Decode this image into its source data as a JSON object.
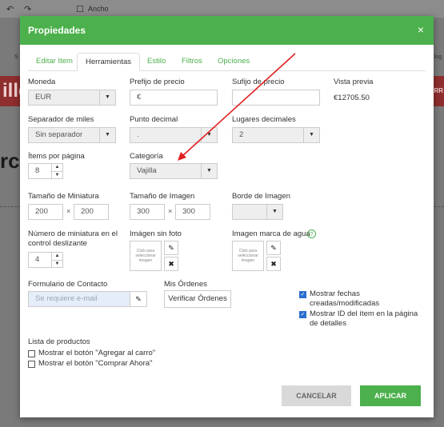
{
  "background": {
    "toolbar_label": "Ancho",
    "red_text_left": "ille",
    "red_text_right": "ARR",
    "big_text": "rc",
    "side_small_left": "S",
    "side_small_right": "log"
  },
  "modal": {
    "title": "Propiedades",
    "close_glyph": "×",
    "accent": "#4cb04c",
    "tabs": [
      {
        "label": "Editar Item"
      },
      {
        "label": "Herramientas"
      },
      {
        "label": "Estilo"
      },
      {
        "label": "Filtros"
      },
      {
        "label": "Opciones"
      }
    ],
    "fields": {
      "moneda": {
        "label": "Moneda",
        "value": "EUR"
      },
      "prefijo": {
        "label": "Prefijo de precio",
        "value": "€"
      },
      "sufijo": {
        "label": "Sufijo de precio",
        "value": ""
      },
      "vista_previa": {
        "label": "Vista previa",
        "value": "€12705.50"
      },
      "separador": {
        "label": "Separador de miles",
        "value": "Sin separador"
      },
      "punto": {
        "label": "Punto decimal",
        "value": "."
      },
      "lugares": {
        "label": "Lugares decimales",
        "value": "2"
      },
      "items_pagina": {
        "label": "Ítems por página",
        "value": "8"
      },
      "categoria": {
        "label": "Categoría",
        "value": "Vajilla"
      },
      "miniatura": {
        "label": "Tamaño de Miniatura",
        "w": "200",
        "h": "200",
        "times": "×"
      },
      "imagen": {
        "label": "Tamaño de Imagen",
        "w": "300",
        "h": "300",
        "times": "×"
      },
      "borde": {
        "label": "Borde de Imagen",
        "value": ""
      },
      "num_miniatura": {
        "label": "Número de miniatura en el control deslizante",
        "value": "4"
      },
      "sin_foto": {
        "label": "Imágen sin foto",
        "placeholder": "Click para seleccionar imagen"
      },
      "marca_agua": {
        "label": "Imagen marca de agua",
        "placeholder": "Click para seleccionar imagen",
        "help": "?"
      },
      "formulario": {
        "label": "Formulario de Contacto",
        "placeholder": "Se requiere e-mail"
      },
      "ordenes": {
        "label": "Mis Órdenes",
        "button": "Verificar Órdenes"
      }
    },
    "checkboxes_right": [
      {
        "label": "Mostrar fechas creadas/modificadas",
        "checked": true
      },
      {
        "label": "Mostrar ID del ítem en la página de detalles",
        "checked": true
      }
    ],
    "lista": {
      "label": "Lista de productos",
      "items": [
        {
          "label": "Mostrar el botón \"Agregar al carro\"",
          "checked": false
        },
        {
          "label": "Mostrar el botón \"Comprar Ahora\"",
          "checked": false
        }
      ]
    },
    "buttons": {
      "cancel": "CANCELAR",
      "apply": "APLICAR"
    },
    "icons": {
      "pencil": "✎",
      "remove": "✖",
      "caret": "▼",
      "up": "▲",
      "down": "▼"
    }
  }
}
